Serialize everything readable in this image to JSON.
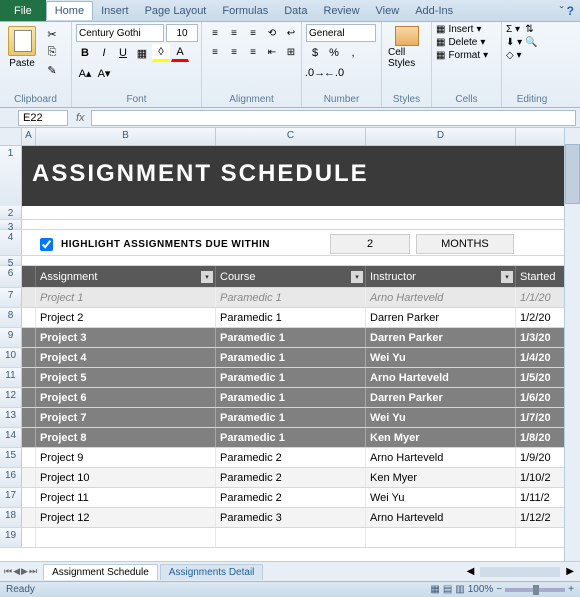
{
  "ribbon": {
    "file": "File",
    "tabs": [
      "Home",
      "Insert",
      "Page Layout",
      "Formulas",
      "Data",
      "Review",
      "View",
      "Add-Ins"
    ],
    "active_tab": "Home",
    "groups": {
      "clipboard": "Clipboard",
      "font": "Font",
      "alignment": "Alignment",
      "number": "Number",
      "styles": "Styles",
      "cells": "Cells",
      "editing": "Editing"
    },
    "paste": "Paste",
    "font_name": "Century Gothi",
    "font_size": "10",
    "number_format": "General",
    "cell_styles": "Cell Styles",
    "cells_items": {
      "insert": "Insert",
      "delete": "Delete",
      "format": "Format"
    }
  },
  "name_box": "E22",
  "formula_bar": "",
  "columns": [
    "A",
    "B",
    "C",
    "D"
  ],
  "sheet": {
    "title": "ASSIGNMENT SCHEDULE",
    "highlight": {
      "label": "HIGHLIGHT ASSIGNMENTS DUE WITHIN",
      "value": "2",
      "unit": "MONTHS",
      "checked": true
    },
    "headers": [
      "Assignment",
      "Course",
      "Instructor",
      "Started"
    ],
    "rows": [
      {
        "n": 7,
        "cls": "r-gray-it",
        "a": "Project 1",
        "c": "Paramedic 1",
        "i": "Arno Harteveld",
        "s": "1/1/20"
      },
      {
        "n": 8,
        "cls": "r-light",
        "a": "Project 2",
        "c": "Paramedic 1",
        "i": "Darren Parker",
        "s": "1/2/20"
      },
      {
        "n": 9,
        "cls": "r-dark",
        "a": "Project 3",
        "c": "Paramedic 1",
        "i": "Darren Parker",
        "s": "1/3/20"
      },
      {
        "n": 10,
        "cls": "r-dark",
        "a": "Project 4",
        "c": "Paramedic 1",
        "i": "Wei Yu",
        "s": "1/4/20"
      },
      {
        "n": 11,
        "cls": "r-dark",
        "a": "Project 5",
        "c": "Paramedic 1",
        "i": "Arno Harteveld",
        "s": "1/5/20"
      },
      {
        "n": 12,
        "cls": "r-dark",
        "a": "Project 6",
        "c": "Paramedic 1",
        "i": "Darren Parker",
        "s": "1/6/20"
      },
      {
        "n": 13,
        "cls": "r-dark",
        "a": "Project 7",
        "c": "Paramedic 1",
        "i": "Wei Yu",
        "s": "1/7/20"
      },
      {
        "n": 14,
        "cls": "r-dark",
        "a": "Project 8",
        "c": "Paramedic 1",
        "i": "Ken Myer",
        "s": "1/8/20"
      },
      {
        "n": 15,
        "cls": "r-light",
        "a": "Project 9",
        "c": "Paramedic 2",
        "i": "Arno Harteveld",
        "s": "1/9/20"
      },
      {
        "n": 16,
        "cls": "r-alt",
        "a": "Project 10",
        "c": "Paramedic 2",
        "i": "Ken Myer",
        "s": "1/10/2"
      },
      {
        "n": 17,
        "cls": "r-light",
        "a": "Project 11",
        "c": "Paramedic 2",
        "i": "Wei Yu",
        "s": "1/11/2"
      },
      {
        "n": 18,
        "cls": "r-alt",
        "a": "Project 12",
        "c": "Paramedic 3",
        "i": "Arno Harteveld",
        "s": "1/12/2"
      }
    ]
  },
  "sheet_tabs": {
    "active": "Assignment Schedule",
    "inactive": "Assignments Detail"
  },
  "status": {
    "ready": "Ready",
    "zoom": "100%"
  }
}
